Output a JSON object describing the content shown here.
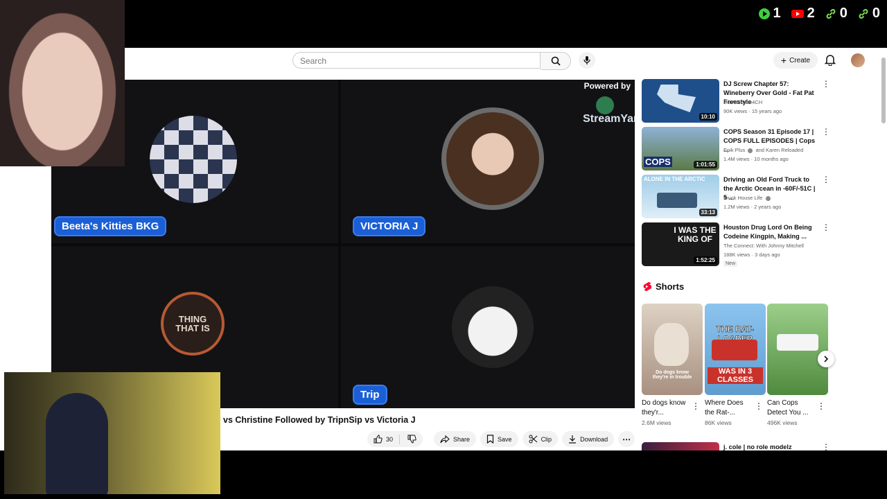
{
  "overlay": {
    "counters": [
      {
        "icon": "play-icon",
        "value": "1",
        "color": "#3ecf3e"
      },
      {
        "icon": "youtube-icon",
        "value": "2",
        "color": "#ff0000"
      },
      {
        "icon": "link-icon",
        "value": "0",
        "color": "#7ed957"
      },
      {
        "icon": "link-icon",
        "value": "0",
        "color": "#7ed957"
      }
    ]
  },
  "header": {
    "search_placeholder": "Search",
    "create_label": "Create"
  },
  "video": {
    "powered_by": "Powered by",
    "brand": "StreamYard",
    "tiles": [
      {
        "name": "Beeta's Kitties BKG"
      },
      {
        "name": "VICTORIA J"
      },
      {
        "name": "",
        "logo_text": "THING THAT IS"
      },
      {
        "name": "Trip"
      }
    ],
    "title": "vs Christine Followed by TripnSip vs Victoria J",
    "like_count": "30",
    "share_label": "Share",
    "save_label": "Save",
    "clip_label": "Clip",
    "download_label": "Download"
  },
  "recommendations": [
    {
      "title": "DJ Screw Chapter 57: Wineberry Over Gold - Fat Pat Freestyle",
      "channel": "DBValentine4CH",
      "meta": "90K views · 15 years ago",
      "duration": "10:10",
      "verified": false,
      "new": false,
      "thumb_color": "#1e4f8a"
    },
    {
      "title": "COPS Season 31 Episode 17 | COPS FULL EPISODES | Cops ...",
      "channel": "Epik Plus",
      "channel_extra": "and Karen Reloaded",
      "meta": "1.4M views · 10 months ago",
      "duration": "1:01:55",
      "verified": true,
      "new": false,
      "thumb_color": "#6b8fb5",
      "thumb_text": "COPS"
    },
    {
      "title": "Driving an Old Ford Truck to the Arctic Ocean in -60F/-51C | 5 ...",
      "channel": "Truck House Life",
      "meta": "1.2M views · 2 years ago",
      "duration": "33:13",
      "verified": true,
      "new": false,
      "thumb_color": "#7fb3d4",
      "thumb_text": "ALONE IN THE ARCTIC"
    },
    {
      "title": "Houston Drug Lord On Being Codeine Kingpin, Making ...",
      "channel": "The Connect: With Johnny Mitchell",
      "meta": "188K views · 3 days ago",
      "duration": "1:52:25",
      "verified": false,
      "new": true,
      "new_label": "New",
      "thumb_color": "#1a1a1a",
      "thumb_text": "I WAS THE KING OF"
    },
    {
      "title": "j. cole | no role modelz",
      "channel": "",
      "meta": "",
      "duration": "",
      "verified": false,
      "new": false,
      "thumb_color": "#3a1f3f"
    }
  ],
  "shorts": {
    "heading": "Shorts",
    "items": [
      {
        "title": "Do dogs know they'r...",
        "views": "2.6M views",
        "thumb_color": "#c9b9a6",
        "caption": "Do dogs know they're in trouble"
      },
      {
        "title": "Where Does the Rat-...",
        "views": "86K views",
        "thumb_color": "#7db8e8",
        "caption": "THE RAT-LOADER",
        "caption2": "WAS IN 3 CLASSES"
      },
      {
        "title": "Can Cops Detect You ...",
        "views": "496K views",
        "thumb_color": "#6aa06a",
        "caption": ""
      }
    ]
  }
}
